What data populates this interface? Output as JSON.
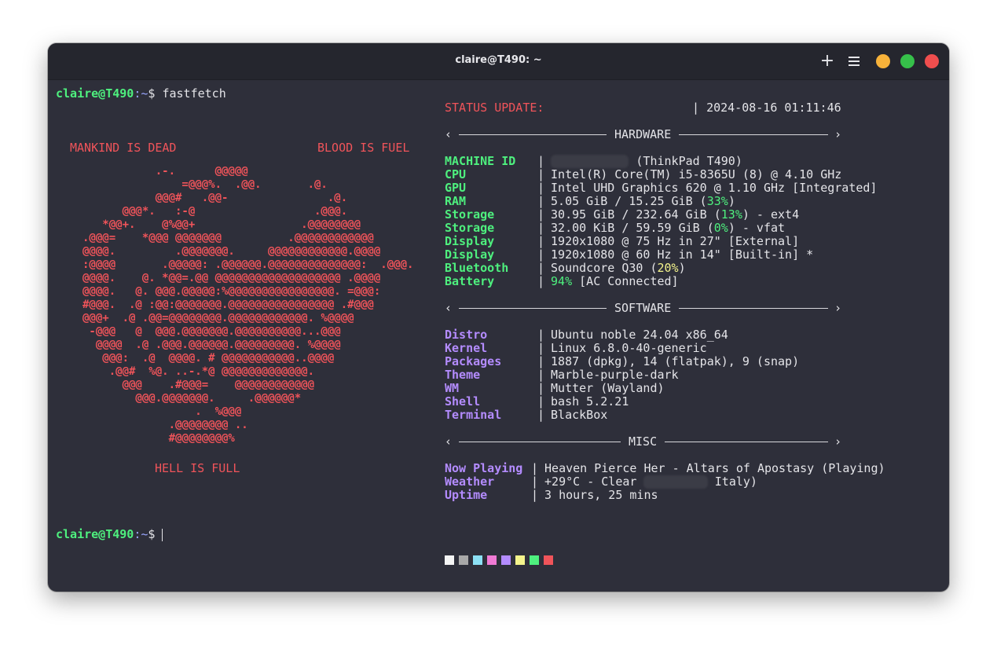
{
  "window": {
    "title": "claire@T490: ~"
  },
  "prompt": {
    "user_host": "claire@T490",
    "path": ":~",
    "symbol": "$",
    "command": "fastfetch"
  },
  "ascii": {
    "art": "           .-.      @@@@@\n               =@@@%.  .@@.       .@.\n           @@@#   .@@-               .@.\n      @@@*.   :-@                  .@@@.\n   *@@+.    @%@@+                .@@@@@@@@\n.@@@=    *@@@ @@@@@@@          .@@@@@@@@@@@@\n@@@@.         .@@@@@@@.     @@@@@@@@@@@@.@@@@\n:@@@@       .@@@@@: .@@@@@@.@@@@@@@@@@@@@@:  .@@@.\n@@@@.    @. *@@=.@@ @@@@@@@@@@@@@@@@@@@ .@@@@\n@@@@.   @. @@@.@@@@@:%@@@@@@@@@@@@@@@@. =@@@:\n#@@@.  .@ :@@:@@@@@@@.@@@@@@@@@@@@@@@@ .#@@@\n@@@+  .@ .@@=@@@@@@@@.@@@@@@@@@@@@. %@@@@\n -@@@   @  @@@.@@@@@@@.@@@@@@@@@@...@@@\n  @@@@  .@ .@@@.@@@@@@.@@@@@@@@@. %@@@@\n   @@@:  .@  @@@@. # @@@@@@@@@@@..@@@@\n    .@@#  %@. ..-.*@ @@@@@@@@@@@@@.\n      @@@    .#@@@=    @@@@@@@@@@@@\n        @@@.@@@@@@@.     .@@@@@@*\n                 .  %@@@\n             .@@@@@@@@ ..\n             #@@@@@@@@%",
    "top_left": "MANKIND IS DEAD",
    "top_right": "BLOOD IS FUEL",
    "bottom": "HELL IS FULL"
  },
  "status": {
    "label": "STATUS UPDATE:",
    "separator": "|",
    "datetime": "2024-08-16 01:11:46"
  },
  "sections": {
    "hardware": "HARDWARE",
    "software": "SOFTWARE",
    "misc": "MISC"
  },
  "hardware": [
    {
      "key": "MACHINE ID",
      "value": " (ThinkPad T490)",
      "redacted": true
    },
    {
      "key": "CPU",
      "value": "Intel(R) Core(TM) i5-8365U (8) @ 4.10 GHz"
    },
    {
      "key": "GPU",
      "value": "Intel UHD Graphics 620 @ 1.10 GHz [Integrated]"
    },
    {
      "key": "RAM",
      "pre": "5.05 GiB / 15.25 GiB (",
      "pct": "33%",
      "post": ")"
    },
    {
      "key": "Storage",
      "pre": "30.95 GiB / 232.64 GiB (",
      "pct": "13%",
      "post": ") - ext4"
    },
    {
      "key": "Storage",
      "pre": "32.00 KiB / 59.59 GiB (",
      "pct": "0%",
      "post": ") - vfat"
    },
    {
      "key": "Display",
      "value": "1920x1080 @ 75 Hz in 27\" [External]"
    },
    {
      "key": "Display",
      "value": "1920x1080 @ 60 Hz in 14\" [Built-in] *"
    },
    {
      "key": "Bluetooth",
      "pre": "Soundcore Q30 (",
      "pct": "20%",
      "post": ")"
    },
    {
      "key": "Battery",
      "pct": "94%",
      "post": " [AC Connected]"
    }
  ],
  "software": [
    {
      "key": "Distro",
      "value": "Ubuntu noble 24.04 x86_64"
    },
    {
      "key": "Kernel",
      "value": "Linux 6.8.0-40-generic"
    },
    {
      "key": "Packages",
      "value": "1887 (dpkg), 14 (flatpak), 9 (snap)"
    },
    {
      "key": "Theme",
      "value": "Marble-purple-dark"
    },
    {
      "key": "WM",
      "value": "Mutter (Wayland)"
    },
    {
      "key": "Shell",
      "value": "bash 5.2.21"
    },
    {
      "key": "Terminal",
      "value": "BlackBox"
    }
  ],
  "misc": [
    {
      "key": "Now Playing",
      "value": "Heaven Pierce Her - Altars of Apostasy (Playing)"
    },
    {
      "key": "Weather",
      "pre": "+29°C - Clear ",
      "post": " Italy)"
    },
    {
      "key": "Uptime",
      "value": "3 hours, 25 mins"
    }
  ],
  "palette": [
    "#f4f4f4",
    "#a8a8a8",
    "#8ce0f4",
    "#f07ad4",
    "#b48cff",
    "#f4f48c",
    "#4ef07e",
    "#f0545a"
  ],
  "colors": {
    "accent_green": "#4ef07e",
    "accent_red": "#f0545a",
    "accent_purple": "#b48cff",
    "accent_yellow": "#f4f48c"
  }
}
